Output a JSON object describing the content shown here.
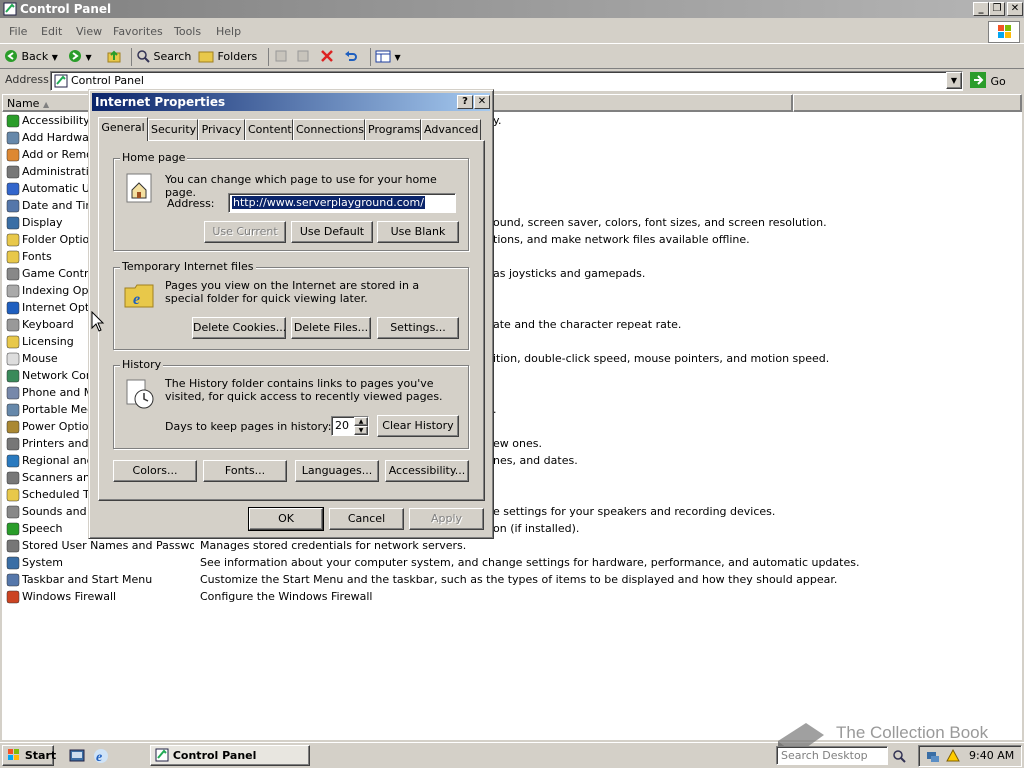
{
  "window": {
    "title": "Control Panel"
  },
  "menubar": {
    "items": [
      "File",
      "Edit",
      "View",
      "Favorites",
      "Tools",
      "Help"
    ]
  },
  "toolbar": {
    "back": "Back",
    "search": "Search",
    "folders": "Folders"
  },
  "address": {
    "label": "Address",
    "value": "Control Panel",
    "go": "Go"
  },
  "list": {
    "header_name": "Name",
    "items": [
      "Accessibility Options",
      "Add Hardware",
      "Add or Remove Programs",
      "Administrative Tools",
      "Automatic Updates",
      "Date and Time",
      "Display",
      "Folder Options",
      "Fonts",
      "Game Controllers",
      "Indexing Options",
      "Internet Options",
      "Keyboard",
      "Licensing",
      "Mouse",
      "Network Connections",
      "Phone and Modem Options",
      "Portable Media Devices",
      "Power Options",
      "Printers and Faxes",
      "Regional and Language Options",
      "Scanners and Cameras",
      "Scheduled Tasks",
      "Sounds and Audio Devices",
      "Speech",
      "Stored User Names and Passwords",
      "System",
      "Taskbar and Start Menu",
      "Windows Firewall"
    ],
    "descriptions": {
      "accessibility": "y.",
      "display": "ound, screen saver, colors, font sizes, and screen resolution.",
      "folder": "tions, and make network files available offline.",
      "game": "as joysticks and gamepads.",
      "keyboard": "ate and the character repeat rate.",
      "mouse": "ition, double-click speed, mouse pointers, and motion speed.",
      "portable": ".",
      "printers": "ew ones.",
      "regional": "nes, and dates.",
      "sounds": "e settings for your speakers and recording devices.",
      "speech": "on (if installed).",
      "stored": "Manages stored credentials for network servers.",
      "system": "See information about your computer system, and change settings for hardware, performance, and automatic updates.",
      "taskbar": "Customize the Start Menu and the taskbar, such as the types of items to be displayed and how they should appear.",
      "firewall": "Configure the Windows Firewall"
    }
  },
  "dialog": {
    "title": "Internet Properties",
    "help": "?",
    "close": "✕",
    "tabs": [
      "General",
      "Security",
      "Privacy",
      "Content",
      "Connections",
      "Programs",
      "Advanced"
    ],
    "home": {
      "legend": "Home page",
      "text": "You can change which page to use for your home page.",
      "address_label": "Address:",
      "address_value": "http://www.serverplayground.com/",
      "use_current": "Use Current",
      "use_default": "Use Default",
      "use_blank": "Use Blank"
    },
    "temp": {
      "legend": "Temporary Internet files",
      "text": "Pages you view on the Internet are stored in a special folder for quick viewing later.",
      "delete_cookies": "Delete Cookies...",
      "delete_files": "Delete Files...",
      "settings": "Settings..."
    },
    "history": {
      "legend": "History",
      "text": "The History folder contains links to pages you've visited, for quick access to recently viewed pages.",
      "days_label": "Days to keep pages in history:",
      "days_value": "20",
      "clear": "Clear History"
    },
    "bottom": {
      "colors": "Colors...",
      "fonts": "Fonts...",
      "languages": "Languages...",
      "accessibility": "Accessibility..."
    },
    "ok": "OK",
    "cancel": "Cancel",
    "apply": "Apply"
  },
  "taskbar": {
    "start": "Start",
    "task": "Control Panel",
    "search_placeholder": "Search Desktop",
    "clock": "9:40 AM",
    "watermark": "The Collection Book"
  }
}
